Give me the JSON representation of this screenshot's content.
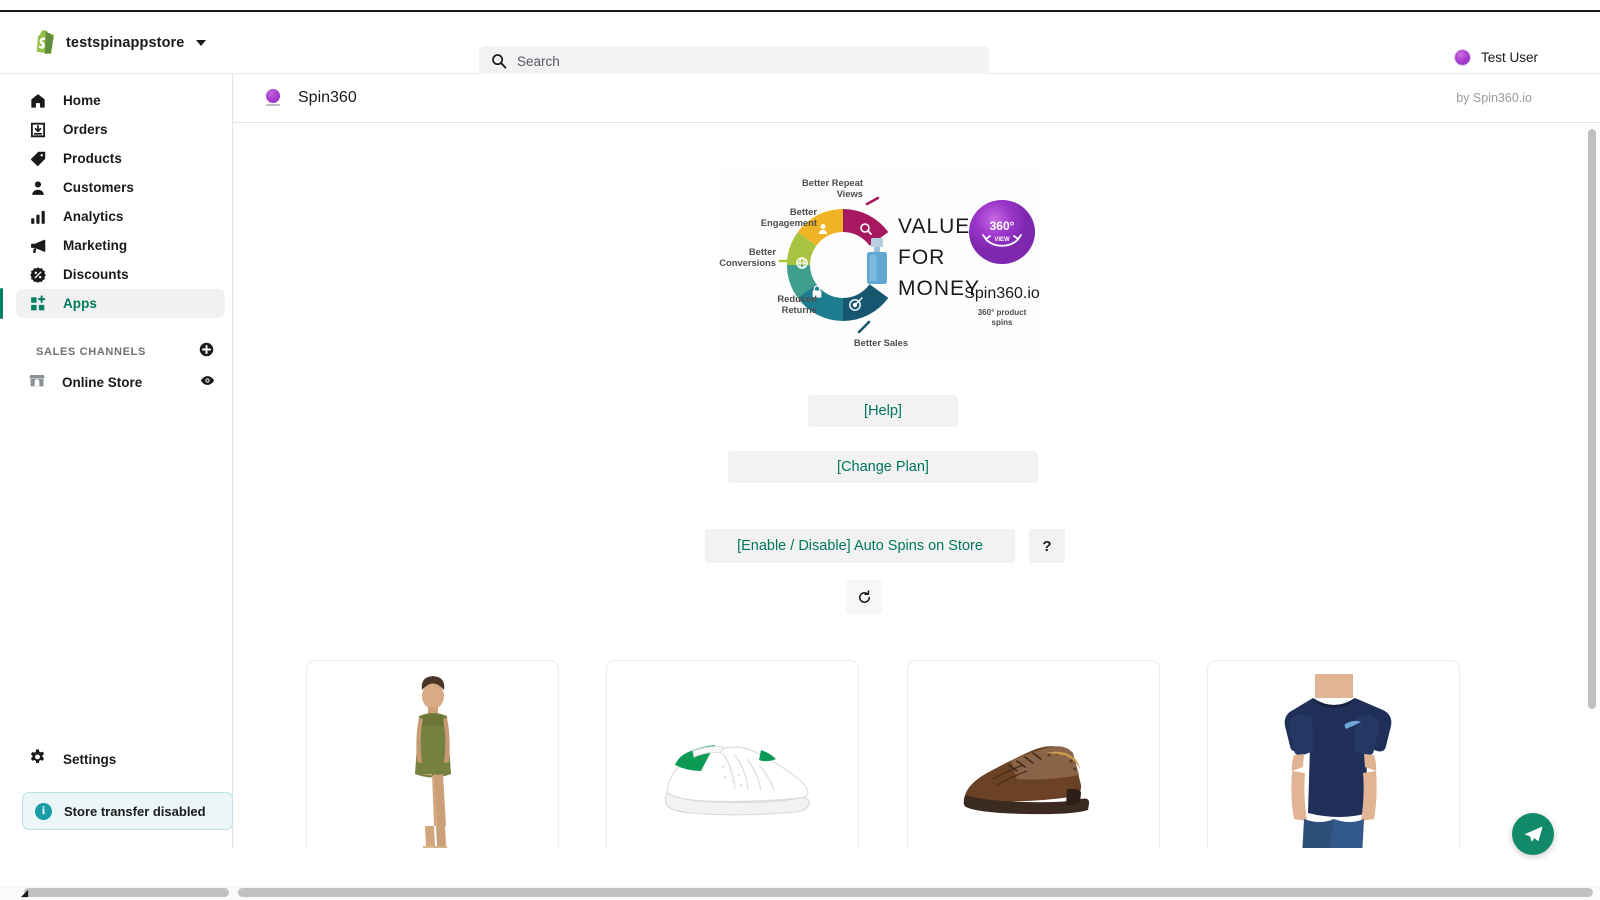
{
  "topbar": {
    "store_name": "testspinappstore",
    "store_switcher_icon": "shopify-bag-logo",
    "caret_icon": "chevron-down-icon",
    "search": {
      "placeholder": "Search",
      "value": "",
      "icon": "search-icon"
    },
    "user": {
      "name": "Test User",
      "avatar_icon": "user-avatar"
    }
  },
  "sidebar": {
    "items": [
      {
        "label": "Home",
        "icon": "home-icon",
        "active": false
      },
      {
        "label": "Orders",
        "icon": "orders-icon",
        "active": false
      },
      {
        "label": "Products",
        "icon": "products-tag-icon",
        "active": false
      },
      {
        "label": "Customers",
        "icon": "customers-icon",
        "active": false
      },
      {
        "label": "Analytics",
        "icon": "analytics-bars-icon",
        "active": false
      },
      {
        "label": "Marketing",
        "icon": "marketing-megaphone-icon",
        "active": false
      },
      {
        "label": "Discounts",
        "icon": "discounts-icon",
        "active": false
      },
      {
        "label": "Apps",
        "icon": "apps-grid-plus-icon",
        "active": true
      }
    ],
    "sales_channels": {
      "header": "SALES CHANNELS",
      "add_icon": "plus-circle-icon",
      "channels": [
        {
          "label": "Online Store",
          "icon": "storefront-icon",
          "action_icon": "eye-icon"
        }
      ]
    },
    "settings": {
      "label": "Settings",
      "icon": "gear-icon"
    },
    "banner": {
      "label": "Store transfer disabled",
      "icon": "info-icon"
    }
  },
  "app": {
    "title": "Spin360",
    "logo_icon": "spin360-logo-icon",
    "byline": "by Spin360.io",
    "infographic": {
      "alt": "Spin360 value for money infographic",
      "center_lines": [
        "VALUE",
        "FOR",
        "MONEY"
      ],
      "labels": [
        "Better Repeat Views",
        "Better Engagement",
        "Better Conversions",
        "Reduced Returns",
        "Better Sales"
      ],
      "brand": "Spin360.io",
      "brand_sub": "360° product spins",
      "badge_top": "360°",
      "badge_bottom": "VIEW"
    },
    "buttons": {
      "help": "[Help]",
      "change_plan": "[Change Plan]",
      "auto_spins": "[Enable / Disable] Auto Spins on Store",
      "question": "?",
      "refresh_icon": "refresh-counterclockwise-icon"
    },
    "products": [
      {
        "name": "olive sleeveless dress on model",
        "icon": "product-thumbnail-dress"
      },
      {
        "name": "white green-heel sneaker",
        "icon": "product-thumbnail-sneaker"
      },
      {
        "name": "brown leather brogue shoe",
        "icon": "product-thumbnail-brogue"
      },
      {
        "name": "navy blue t-shirt on model",
        "icon": "product-thumbnail-tshirt"
      }
    ],
    "fab": {
      "icon": "send-paper-plane-icon",
      "label": ""
    }
  },
  "colors": {
    "accent_green": "#008060",
    "link_green": "#00765a",
    "banner_bg": "#eaf6f7",
    "banner_border": "#b8dfe4",
    "info_icon": "#1a9ba8",
    "fab": "#128a6a",
    "purple": "#a83ecf"
  }
}
